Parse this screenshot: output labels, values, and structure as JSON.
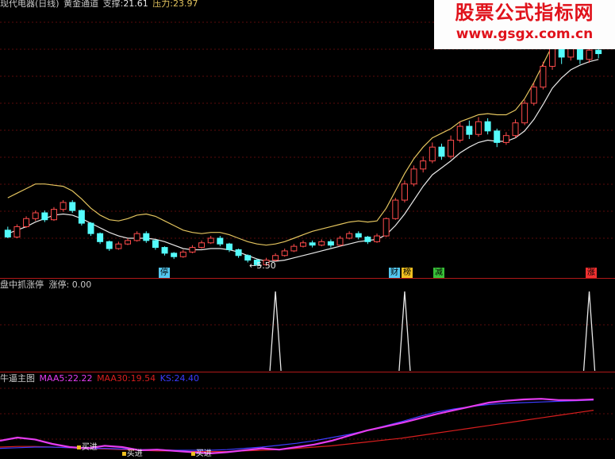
{
  "colors": {
    "bg": "#000000",
    "separator": "#b01818",
    "up_candle": "#ff4b4b",
    "down_candle": "#54fcfc",
    "upper_band": "#e3c45e",
    "lower_band": "#e8e8e8",
    "ma5": "#e43cf0",
    "ma30": "#d81e1e",
    "ks": "#3c3cff",
    "spike": "#e8e8e8"
  },
  "panel1": {
    "header": {
      "stock": "现代电器(日线)",
      "indicator": "黄金通道",
      "support_label": "支撑:",
      "support_value": "21.61",
      "pressure_label": "压力:",
      "pressure_value": "23.97"
    },
    "low_marker": "5.50",
    "tags": [
      {
        "text": "停",
        "color": "#54c8f0"
      },
      {
        "text": "财",
        "color": "#54c8f0"
      },
      {
        "text": "榜",
        "color": "#f0c020"
      },
      {
        "text": "减",
        "color": "#38c038"
      },
      {
        "text": "涨",
        "color": "#f03030"
      }
    ]
  },
  "panel2": {
    "title": "盘中抓涨停",
    "field_label": "涨停:",
    "field_value": "0.00"
  },
  "panel3": {
    "title": "牛逼主图",
    "ma5_label": "MAA5:",
    "ma5_value": "22.22",
    "ma30_label": "MAA30:",
    "ma30_value": "19.54",
    "ks_label": "KS:",
    "ks_value": "24.40",
    "buy_signals": [
      "买进",
      "买进",
      "买进"
    ]
  },
  "watermark": {
    "line1": "股票公式指标网",
    "line2": "www.gsgx.com.cn"
  },
  "chart_data": {
    "type": "line",
    "candles": [
      [
        8.6,
        8.0,
        8.9,
        7.9
      ],
      [
        8.0,
        8.9,
        9.1,
        7.9
      ],
      [
        8.9,
        9.6,
        9.8,
        8.8
      ],
      [
        9.6,
        10.1,
        10.3,
        9.4
      ],
      [
        10.1,
        9.5,
        10.3,
        9.3
      ],
      [
        9.5,
        10.4,
        10.6,
        9.4
      ],
      [
        10.4,
        11.0,
        11.2,
        10.2
      ],
      [
        11.0,
        10.3,
        11.2,
        10.1
      ],
      [
        10.3,
        9.2,
        10.4,
        9.0
      ],
      [
        9.2,
        8.3,
        9.3,
        8.1
      ],
      [
        8.3,
        7.6,
        8.4,
        7.4
      ],
      [
        7.6,
        7.0,
        7.7,
        6.8
      ],
      [
        7.0,
        7.4,
        7.6,
        6.9
      ],
      [
        7.4,
        7.7,
        7.9,
        7.3
      ],
      [
        7.7,
        8.3,
        8.5,
        7.6
      ],
      [
        8.3,
        7.7,
        8.5,
        7.5
      ],
      [
        7.7,
        7.1,
        7.8,
        6.9
      ],
      [
        7.1,
        6.6,
        7.2,
        6.4
      ],
      [
        6.6,
        6.3,
        6.7,
        6.1
      ],
      [
        6.3,
        6.7,
        6.9,
        6.2
      ],
      [
        6.7,
        7.1,
        7.3,
        6.6
      ],
      [
        7.1,
        7.5,
        7.7,
        7.0
      ],
      [
        7.5,
        7.9,
        8.1,
        7.4
      ],
      [
        7.9,
        7.4,
        8.1,
        7.2
      ],
      [
        7.4,
        6.9,
        7.5,
        6.7
      ],
      [
        6.9,
        6.4,
        7.0,
        6.2
      ],
      [
        6.4,
        6.0,
        6.5,
        5.8
      ],
      [
        6.0,
        5.6,
        6.1,
        5.5
      ],
      [
        5.6,
        6.0,
        6.2,
        5.5
      ],
      [
        6.0,
        6.4,
        6.6,
        5.9
      ],
      [
        6.4,
        6.8,
        7.0,
        6.3
      ],
      [
        6.8,
        7.2,
        7.4,
        6.7
      ],
      [
        7.2,
        7.5,
        7.7,
        7.1
      ],
      [
        7.5,
        7.3,
        7.7,
        7.1
      ],
      [
        7.3,
        7.6,
        7.8,
        7.2
      ],
      [
        7.6,
        7.3,
        7.8,
        7.1
      ],
      [
        7.3,
        7.9,
        8.1,
        7.2
      ],
      [
        7.9,
        8.3,
        8.5,
        7.8
      ],
      [
        8.3,
        8.0,
        8.5,
        7.8
      ],
      [
        8.0,
        7.6,
        8.1,
        7.4
      ],
      [
        7.6,
        8.1,
        8.3,
        7.5
      ],
      [
        8.1,
        9.6,
        9.7,
        8.0
      ],
      [
        9.6,
        11.2,
        11.4,
        9.5
      ],
      [
        11.2,
        12.6,
        12.9,
        11.0
      ],
      [
        12.6,
        13.9,
        14.2,
        12.4
      ],
      [
        13.9,
        14.6,
        15.0,
        13.6
      ],
      [
        14.6,
        15.8,
        16.2,
        14.4
      ],
      [
        15.8,
        15.0,
        16.1,
        14.7
      ],
      [
        15.0,
        16.4,
        16.8,
        14.8
      ],
      [
        16.4,
        17.6,
        18.0,
        16.2
      ],
      [
        17.6,
        16.9,
        18.1,
        16.5
      ],
      [
        16.9,
        18.0,
        18.4,
        16.7
      ],
      [
        18.0,
        17.2,
        18.3,
        16.9
      ],
      [
        17.2,
        16.2,
        17.4,
        15.8
      ],
      [
        16.2,
        16.8,
        17.1,
        16.0
      ],
      [
        16.8,
        17.9,
        18.2,
        16.6
      ],
      [
        17.9,
        19.6,
        19.9,
        17.7
      ],
      [
        19.6,
        21.0,
        21.4,
        19.4
      ],
      [
        21.0,
        22.8,
        23.2,
        20.8
      ],
      [
        22.8,
        24.5,
        24.9,
        22.5
      ],
      [
        24.5,
        23.6,
        25.0,
        23.0
      ],
      [
        23.6,
        24.7,
        25.1,
        23.3
      ],
      [
        24.7,
        23.4,
        25.0,
        23.0
      ],
      [
        23.4,
        24.2,
        24.6,
        23.1
      ],
      [
        24.2,
        23.9,
        24.5,
        23.5
      ]
    ],
    "upper_band": [
      11.4,
      11.8,
      12.2,
      12.6,
      12.6,
      12.5,
      12.4,
      12.0,
      11.3,
      10.5,
      9.9,
      9.5,
      9.4,
      9.6,
      9.9,
      10.0,
      9.8,
      9.4,
      9.0,
      8.6,
      8.4,
      8.3,
      8.4,
      8.4,
      8.2,
      7.9,
      7.6,
      7.4,
      7.3,
      7.4,
      7.6,
      7.9,
      8.2,
      8.5,
      8.7,
      8.9,
      9.1,
      9.3,
      9.4,
      9.3,
      9.4,
      10.5,
      12.0,
      13.5,
      14.8,
      15.8,
      16.6,
      17.0,
      17.4,
      18.0,
      18.3,
      18.6,
      18.7,
      18.6,
      18.6,
      19.0,
      20.0,
      21.4,
      23.0,
      24.6,
      25.4,
      25.8,
      26.0,
      26.2,
      26.3
    ],
    "lower_band": [
      8.3,
      8.6,
      8.9,
      9.3,
      9.6,
      9.9,
      10.0,
      9.9,
      9.6,
      9.2,
      8.8,
      8.4,
      8.1,
      7.9,
      7.9,
      7.9,
      7.8,
      7.6,
      7.3,
      7.0,
      6.9,
      6.9,
      7.0,
      7.0,
      6.9,
      6.7,
      6.4,
      6.1,
      5.9,
      5.9,
      6.0,
      6.2,
      6.4,
      6.6,
      6.8,
      7.0,
      7.2,
      7.4,
      7.6,
      7.7,
      7.8,
      8.2,
      9.0,
      10.0,
      11.2,
      12.4,
      13.4,
      14.0,
      14.6,
      15.3,
      15.8,
      16.2,
      16.4,
      16.3,
      16.3,
      16.6,
      17.2,
      18.2,
      19.5,
      20.9,
      21.8,
      22.5,
      22.9,
      23.2,
      23.4
    ],
    "low_marker_value": 5.5,
    "y_range": [
      4.8,
      28
    ],
    "zt_spikes_candle_index": [
      29,
      43,
      63
    ],
    "ma5": [
      0.2,
      0.25,
      0.22,
      0.15,
      0.1,
      0.08,
      0.12,
      0.1,
      0.05,
      0.06,
      0.04,
      0.02,
      0.0,
      0.02,
      0.05,
      0.08,
      0.06,
      0.1,
      0.14,
      0.2,
      0.28,
      0.36,
      0.42,
      0.48,
      0.55,
      0.62,
      0.68,
      0.74,
      0.8,
      0.83,
      0.85,
      0.86,
      0.84,
      0.84,
      0.85
    ],
    "ma30": [
      0.1,
      0.11,
      0.11,
      0.1,
      0.09,
      0.08,
      0.07,
      0.06,
      0.05,
      0.04,
      0.04,
      0.03,
      0.03,
      0.03,
      0.04,
      0.05,
      0.06,
      0.08,
      0.1,
      0.12,
      0.15,
      0.18,
      0.21,
      0.24,
      0.28,
      0.32,
      0.36,
      0.4,
      0.44,
      0.48,
      0.52,
      0.56,
      0.6,
      0.64,
      0.68
    ],
    "ks": [
      0.08,
      0.09,
      0.1,
      0.1,
      0.09,
      0.08,
      0.08,
      0.07,
      0.06,
      0.06,
      0.05,
      0.05,
      0.05,
      0.06,
      0.08,
      0.1,
      0.13,
      0.16,
      0.2,
      0.25,
      0.3,
      0.36,
      0.43,
      0.5,
      0.58,
      0.65,
      0.7,
      0.74,
      0.77,
      0.79,
      0.8,
      0.81,
      0.82,
      0.83,
      0.84
    ]
  }
}
